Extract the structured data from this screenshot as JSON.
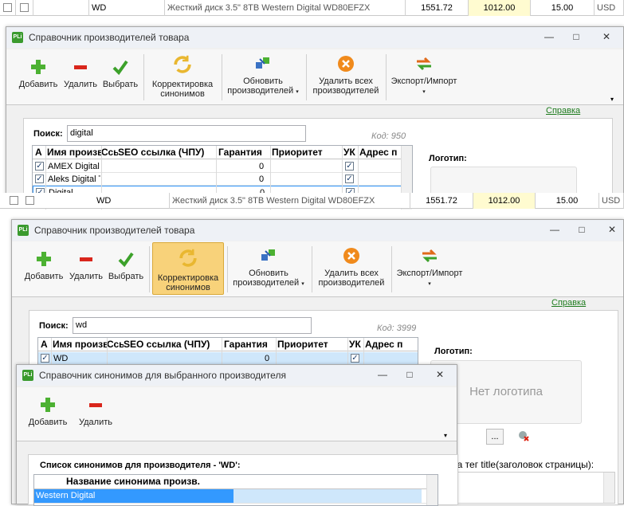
{
  "top_row": {
    "brand": "WD",
    "name": "Жесткий диск 3.5\" 8TB Western Digital WD80EFZX",
    "price1": "1551.72",
    "price2": "1012.00",
    "qty": "15.00",
    "currency": "USD"
  },
  "window1": {
    "title": "Справочник производителей товара",
    "toolbar": {
      "add": "Добавить",
      "delete": "Удалить",
      "select": "Выбрать",
      "synonyms_1": "Корректировка",
      "synonyms_2": "синонимов",
      "refresh_1": "Обновить",
      "refresh_2": "производителей",
      "delete_all_1": "Удалить всех",
      "delete_all_2": "производителей",
      "export_import": "Экспорт/Импорт"
    },
    "help": "Справка",
    "search_label": "Поиск:",
    "search_value": "digital",
    "code": "Код: 950",
    "columns": [
      "A",
      "Имя произв",
      "Ссы",
      "SEO ссылка (ЧПУ)",
      "Гарантия",
      "Приоритет",
      "УК",
      "Адрес п"
    ],
    "rows": [
      {
        "name": "AMEX Digital",
        "priority": "0"
      },
      {
        "name": "Aleks Digital T",
        "priority": "0"
      },
      {
        "name": "Digital",
        "priority": "0"
      }
    ],
    "logo_label": "Логотип:"
  },
  "window2": {
    "title": "Справочник производителей товара",
    "toolbar": {
      "add": "Добавить",
      "delete": "Удалить",
      "select": "Выбрать",
      "synonyms_1": "Корректировка",
      "synonyms_2": "синонимов",
      "refresh_1": "Обновить",
      "refresh_2": "производителей",
      "delete_all_1": "Удалить всех",
      "delete_all_2": "производителей",
      "export_import": "Экспорт/Импорт"
    },
    "help": "Справка",
    "search_label": "Поиск:",
    "search_value": "wd",
    "code": "Код: 3999",
    "columns": [
      "A",
      "Имя произв",
      "Ссы",
      "SEO ссылка (ЧПУ)",
      "Гарантия",
      "Приоритет",
      "УК",
      "Адрес п"
    ],
    "rows": [
      {
        "name": "WD",
        "priority": "0"
      }
    ],
    "logo_label": "Логотип:",
    "no_logo": "Нет логотипа",
    "browse": "...",
    "title_tag_label": "ра тег title(заголовок страницы):"
  },
  "window3": {
    "title": "Справочник синонимов для выбранного производителя",
    "toolbar": {
      "add": "Добавить",
      "delete": "Удалить"
    },
    "list_label": "Список синонимов для производителя - 'WD':",
    "column": "Название синонима произв.",
    "rows": [
      "Western Digital"
    ]
  },
  "colors": {
    "accent_green": "#3a9a2e",
    "link_green": "#1e7b1e",
    "selection_blue": "#3399ff",
    "price_highlight": "#fffbd0",
    "active_button": "#f8d27a"
  }
}
